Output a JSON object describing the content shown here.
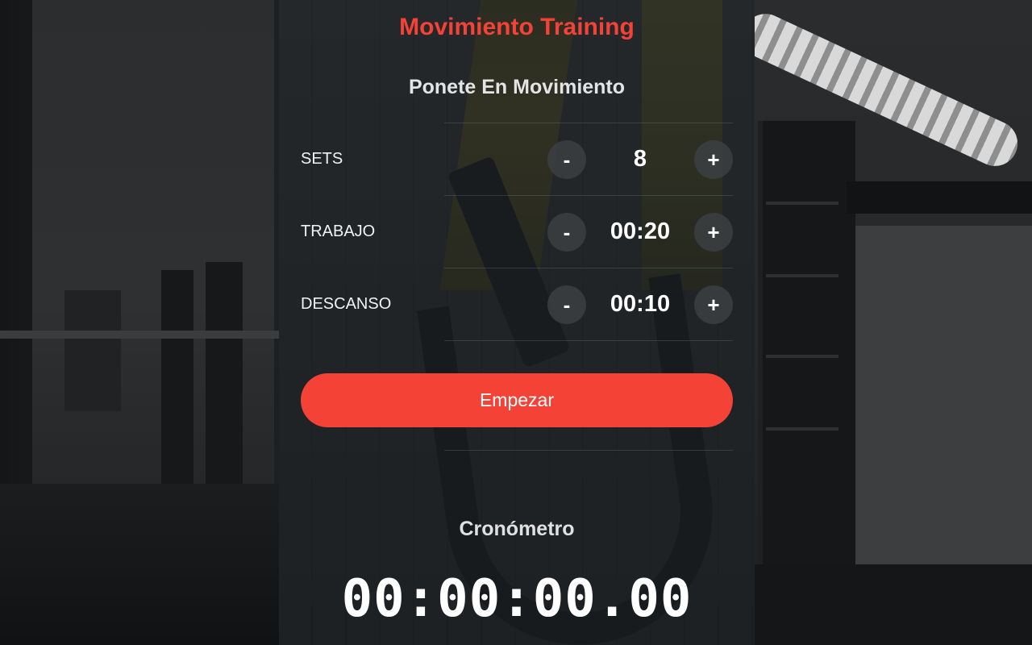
{
  "app": {
    "title": "Movimiento Training",
    "subtitle": "Ponete En Movimiento"
  },
  "settings": [
    {
      "label": "SETS",
      "value": "8",
      "minus_label": "-",
      "plus_label": "+"
    },
    {
      "label": "TRABAJO",
      "value": "00:20",
      "minus_label": "-",
      "plus_label": "+"
    },
    {
      "label": "DESCANSO",
      "value": "00:10",
      "minus_label": "-",
      "plus_label": "+"
    }
  ],
  "start_button": {
    "label": "Empezar"
  },
  "stopwatch": {
    "title": "Cronómetro",
    "time": "00:00:00.00"
  },
  "colors": {
    "accent": "#f44336",
    "text": "#ffffff"
  }
}
